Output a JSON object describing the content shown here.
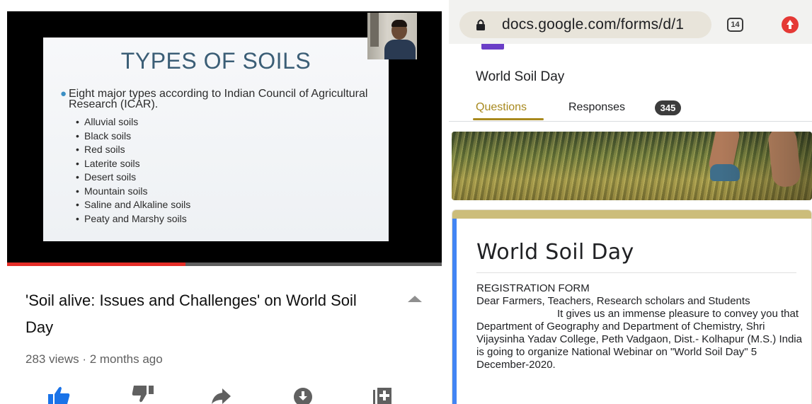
{
  "video": {
    "slide": {
      "title": "TYPES OF SOILS",
      "intro": "Eight major types according to Indian Council of Agricultural Research (ICAR).",
      "items": [
        "Alluvial soils",
        "Black soils",
        "Red soils",
        "Laterite soils",
        "Desert soils",
        "Mountain soils",
        "Saline and Alkaline soils",
        "Peaty and Marshy soils"
      ]
    },
    "progress_fraction": 0.41,
    "progress_color": "#e52d27",
    "title": "'Soil alive: Issues and Challenges' on World Soil Day",
    "meta": "283 views · 2 months ago",
    "actions": [
      {
        "name": "like-icon",
        "color": "#1a73e8"
      },
      {
        "name": "dislike-icon",
        "color": "#606060"
      },
      {
        "name": "share-icon",
        "color": "#606060"
      },
      {
        "name": "download-icon",
        "color": "#606060"
      },
      {
        "name": "save-icon",
        "color": "#606060"
      }
    ]
  },
  "browser": {
    "url": "docs.google.com/forms/d/1",
    "tab_count": "14"
  },
  "form": {
    "header_title": "World Soil Day",
    "tabs": {
      "questions": "Questions",
      "responses": "Responses",
      "responses_count": "345"
    },
    "accent_color": "#a8891e",
    "card": {
      "title": "World Soil Day",
      "description": [
        "REGISTRATION FORM",
        "Dear Farmers, Teachers, Research scholars and Students",
        "It gives us an immense pleasure to convey you that Department of Geography and Department of Chemistry, Shri Vijaysinha Yadav College, Peth Vadgaon, Dist.- Kolhapur (M.S.) India is going to organize National Webinar on \"World Soil Day\" 5 December-2020."
      ]
    }
  }
}
